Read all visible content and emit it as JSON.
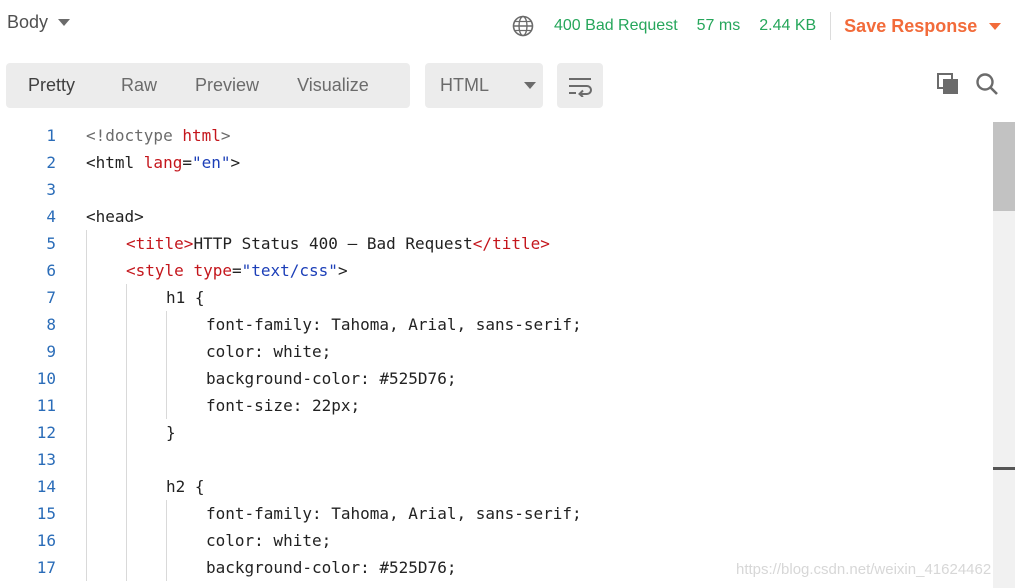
{
  "header": {
    "body_label": "Body",
    "status": "400 Bad Request",
    "time": "57 ms",
    "size": "2.44 KB",
    "save_label": "Save Response",
    "colors": {
      "status_green": "#26a65b",
      "save_orange": "#f26b3a"
    }
  },
  "toolbar": {
    "tabs": [
      "Pretty",
      "Raw",
      "Preview",
      "Visualize"
    ],
    "active_tab": "Pretty",
    "format": "HTML",
    "icons": [
      "wrap-lines-icon",
      "copy-icon",
      "search-icon"
    ]
  },
  "code": {
    "lines": [
      {
        "n": "1",
        "indent": 0,
        "tokens": [
          [
            "gray",
            "<!doctype "
          ],
          [
            "attr",
            "html"
          ],
          [
            "gray",
            ">"
          ]
        ]
      },
      {
        "n": "2",
        "indent": 0,
        "tokens": [
          [
            "tag",
            "<html "
          ],
          [
            "attr",
            "lang"
          ],
          [
            "tag",
            "="
          ],
          [
            "val",
            "\"en\""
          ],
          [
            "tag",
            ">"
          ]
        ]
      },
      {
        "n": "3",
        "indent": 0,
        "tokens": []
      },
      {
        "n": "4",
        "indent": 0,
        "tokens": [
          [
            "tag",
            "<head>"
          ]
        ]
      },
      {
        "n": "5",
        "indent": 1,
        "tokens": [
          [
            "attr",
            "<title>"
          ],
          [
            "plain",
            "HTTP Status 400 – Bad Request"
          ],
          [
            "attr",
            "</title>"
          ]
        ]
      },
      {
        "n": "6",
        "indent": 1,
        "tokens": [
          [
            "attr",
            "<style "
          ],
          [
            "attr",
            "type"
          ],
          [
            "tag",
            "="
          ],
          [
            "val",
            "\"text/css\""
          ],
          [
            "tag",
            ">"
          ]
        ]
      },
      {
        "n": "7",
        "indent": 2,
        "tokens": [
          [
            "plain",
            "h1 {"
          ]
        ]
      },
      {
        "n": "8",
        "indent": 3,
        "tokens": [
          [
            "plain",
            "font-family: Tahoma, Arial, sans-serif;"
          ]
        ]
      },
      {
        "n": "9",
        "indent": 3,
        "tokens": [
          [
            "plain",
            "color: white;"
          ]
        ]
      },
      {
        "n": "10",
        "indent": 3,
        "tokens": [
          [
            "plain",
            "background-color: #525D76;"
          ]
        ]
      },
      {
        "n": "11",
        "indent": 3,
        "tokens": [
          [
            "plain",
            "font-size: 22px;"
          ]
        ]
      },
      {
        "n": "12",
        "indent": 2,
        "tokens": [
          [
            "plain",
            "}"
          ]
        ]
      },
      {
        "n": "13",
        "indent": 0,
        "tokens": []
      },
      {
        "n": "14",
        "indent": 2,
        "tokens": [
          [
            "plain",
            "h2 {"
          ]
        ]
      },
      {
        "n": "15",
        "indent": 3,
        "tokens": [
          [
            "plain",
            "font-family: Tahoma, Arial, sans-serif;"
          ]
        ]
      },
      {
        "n": "16",
        "indent": 3,
        "tokens": [
          [
            "plain",
            "color: white;"
          ]
        ]
      },
      {
        "n": "17",
        "indent": 3,
        "tokens": [
          [
            "plain",
            "background-color: #525D76;"
          ]
        ]
      }
    ]
  },
  "watermark": "https://blog.csdn.net/weixin_41624462"
}
